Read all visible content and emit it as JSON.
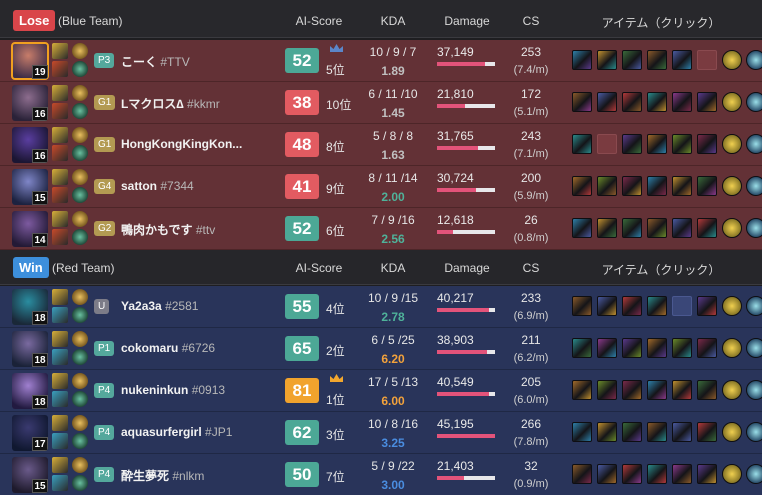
{
  "blue_team": {
    "result": "Lose",
    "team_label": "(Blue Team)",
    "columns": {
      "ai_score": "AI-Score",
      "kda": "KDA",
      "damage": "Damage",
      "cs": "CS",
      "items": "アイテム（クリック）"
    },
    "players": [
      {
        "level": "19",
        "rank": "P3",
        "name": "こーく",
        "tag": "#TTV",
        "score": "52",
        "place": "5位",
        "mvp": true,
        "kda": "10 / 9 / 7",
        "ratio": "1.89",
        "ratio_color": "gray",
        "damage": "37,149",
        "damage_pct": 0.82,
        "cs": "253",
        "cspm": "(7.4/m)",
        "mine": true
      },
      {
        "level": "16",
        "rank": "G1",
        "name": "Lマクロス∆",
        "tag": "#kkmr",
        "score": "38",
        "place": "10位",
        "mvp": false,
        "kda": "6 / 11 /10",
        "ratio": "1.45",
        "ratio_color": "gray",
        "damage": "21,810",
        "damage_pct": 0.48,
        "cs": "172",
        "cspm": "(5.1/m)",
        "mine": false
      },
      {
        "level": "16",
        "rank": "G1",
        "name": "HongKongKingKon...",
        "tag": "",
        "score": "48",
        "place": "8位",
        "mvp": false,
        "kda": "5 / 8 / 8",
        "ratio": "1.63",
        "ratio_color": "gray",
        "damage": "31,765",
        "damage_pct": 0.7,
        "cs": "243",
        "cspm": "(7.1/m)",
        "mine": false
      },
      {
        "level": "15",
        "rank": "G4",
        "name": "satton",
        "tag": "#7344",
        "score": "41",
        "place": "9位",
        "mvp": false,
        "kda": "8 / 11 /14",
        "ratio": "2.00",
        "ratio_color": "green",
        "damage": "30,724",
        "damage_pct": 0.68,
        "cs": "200",
        "cspm": "(5.9/m)",
        "mine": false
      },
      {
        "level": "14",
        "rank": "G2",
        "name": "鴨肉かもです",
        "tag": "#ttv",
        "score": "52",
        "place": "6位",
        "mvp": false,
        "kda": "7 / 9 /16",
        "ratio": "2.56",
        "ratio_color": "green",
        "damage": "12,618",
        "damage_pct": 0.28,
        "cs": "26",
        "cspm": "(0.8/m)",
        "mine": false
      }
    ]
  },
  "red_team": {
    "result": "Win",
    "team_label": "(Red Team)",
    "columns": {
      "ai_score": "AI-Score",
      "kda": "KDA",
      "damage": "Damage",
      "cs": "CS",
      "items": "アイテム（クリック）"
    },
    "players": [
      {
        "level": "18",
        "rank": "U",
        "name": "Ya2a3a",
        "tag": "#2581",
        "score": "55",
        "place": "4位",
        "mvp": false,
        "kda": "10 / 9 /15",
        "ratio": "2.78",
        "ratio_color": "green",
        "damage": "40,217",
        "damage_pct": 0.89,
        "cs": "233",
        "cspm": "(6.9/m)",
        "mine": false
      },
      {
        "level": "18",
        "rank": "P1",
        "name": "cokomaru",
        "tag": "#6726",
        "score": "65",
        "place": "2位",
        "mvp": false,
        "kda": "6 / 5 /25",
        "ratio": "6.20",
        "ratio_color": "orange",
        "damage": "38,903",
        "damage_pct": 0.86,
        "cs": "211",
        "cspm": "(6.2/m)",
        "mine": false
      },
      {
        "level": "18",
        "rank": "P4",
        "name": "nukeninkun",
        "tag": "#0913",
        "score": "81",
        "place": "1位",
        "mvp": true,
        "kda": "17 / 5 /13",
        "ratio": "6.00",
        "ratio_color": "orange",
        "damage": "40,549",
        "damage_pct": 0.9,
        "cs": "205",
        "cspm": "(6.0/m)",
        "mine": false
      },
      {
        "level": "17",
        "rank": "P4",
        "name": "aquasurfergirl",
        "tag": "#JP1",
        "score": "62",
        "place": "3位",
        "mvp": false,
        "kda": "10 / 8 /16",
        "ratio": "3.25",
        "ratio_color": "blue",
        "damage": "45,195",
        "damage_pct": 1.0,
        "cs": "266",
        "cspm": "(7.8/m)",
        "mine": false
      },
      {
        "level": "15",
        "rank": "P4",
        "name": "酔生夢死",
        "tag": "#nlkm",
        "score": "50",
        "place": "7位",
        "mvp": false,
        "kda": "5 / 9 /22",
        "ratio": "3.00",
        "ratio_color": "blue",
        "damage": "21,403",
        "damage_pct": 0.47,
        "cs": "32",
        "cspm": "(0.9/m)",
        "mine": false
      }
    ]
  },
  "colors": {
    "blue_row": "#633136",
    "red_row": "#29345a",
    "lose_badge": "#d9454a",
    "win_badge": "#3d8fdc",
    "damage_bar": "#e3537a",
    "mvp_crown_blue": "#5b86c9",
    "mvp_crown_gold": "#f2a72e"
  }
}
